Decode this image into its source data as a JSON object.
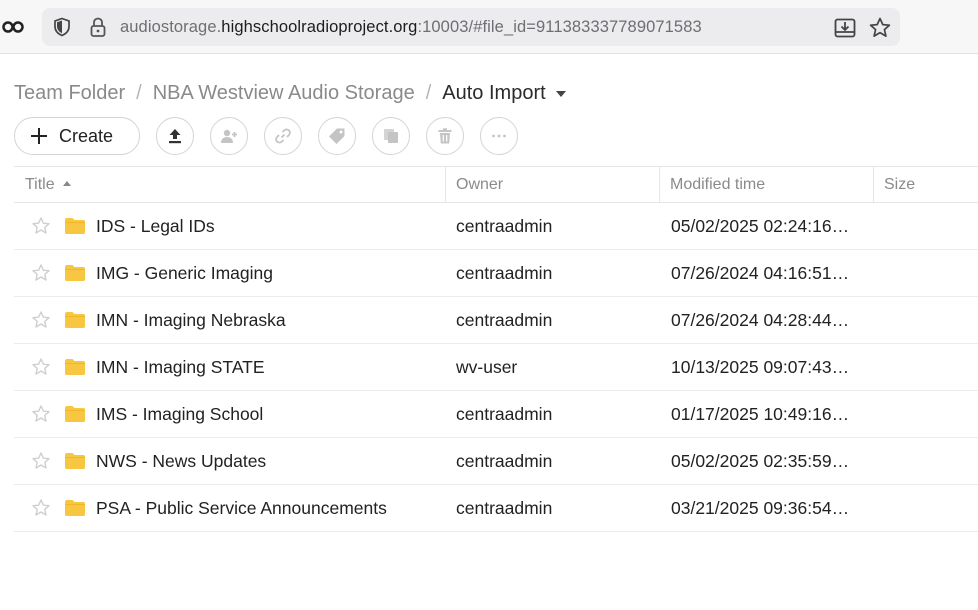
{
  "browser": {
    "url_prefix": "audiostorage.",
    "url_host": "highschoolradioproject.org",
    "url_suffix": ":10003/#file_id=911383337789071583"
  },
  "breadcrumb": {
    "items": [
      "Team Folder",
      "NBA Westview Audio Storage"
    ],
    "separator": "/",
    "current": "Auto Import"
  },
  "toolbar": {
    "create_label": "Create",
    "icons": [
      "upload-icon",
      "share-user-icon",
      "link-icon",
      "tag-icon",
      "copy-icon",
      "delete-icon",
      "more-icon"
    ]
  },
  "table": {
    "columns": {
      "title": "Title",
      "owner": "Owner",
      "modified": "Modified time",
      "size": "Size"
    },
    "rows": [
      {
        "title": "IDS - Legal IDs",
        "owner": "centraadmin",
        "modified": "05/02/2025 02:24:16…"
      },
      {
        "title": "IMG - Generic Imaging",
        "owner": "centraadmin",
        "modified": "07/26/2024 04:16:51…"
      },
      {
        "title": "IMN - Imaging Nebraska",
        "owner": "centraadmin",
        "modified": "07/26/2024 04:28:44…"
      },
      {
        "title": "IMN - Imaging STATE",
        "owner": "wv-user",
        "modified": "10/13/2025 09:07:43…"
      },
      {
        "title": "IMS - Imaging School",
        "owner": "centraadmin",
        "modified": "01/17/2025 10:49:16…"
      },
      {
        "title": "NWS - News Updates",
        "owner": "centraadmin",
        "modified": "05/02/2025 02:35:59…"
      },
      {
        "title": "PSA - Public Service Announcements",
        "owner": "centraadmin",
        "modified": "03/21/2025 09:36:54…"
      }
    ]
  },
  "colors": {
    "folder": "#f8c742",
    "border": "#e6e6e6",
    "muted_text": "#8a8a8a"
  }
}
